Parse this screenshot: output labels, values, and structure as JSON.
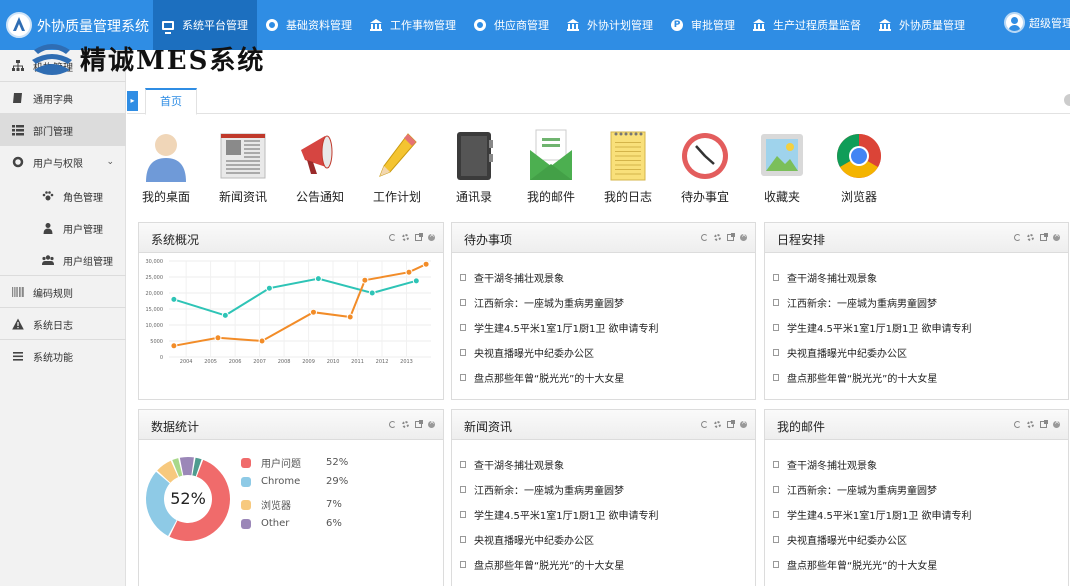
{
  "app": {
    "title": "外协质量管理系统"
  },
  "nav": [
    {
      "label": "系统平台管理",
      "icon": "monitor-icon",
      "active": true
    },
    {
      "label": "基础资料管理",
      "icon": "dot-circle-icon"
    },
    {
      "label": "工作事物管理",
      "icon": "bank-icon"
    },
    {
      "label": "供应商管理",
      "icon": "dot-circle-icon"
    },
    {
      "label": "外协计划管理",
      "icon": "bank-icon"
    },
    {
      "label": "审批管理",
      "icon": "p-badge-icon"
    },
    {
      "label": "生产过程质量监督",
      "icon": "bank-icon"
    },
    {
      "label": "外协质量管理",
      "icon": "bank-icon"
    }
  ],
  "user": {
    "name": "超级管理"
  },
  "watermark": {
    "text": "精诚MES系统"
  },
  "sidebar": [
    {
      "label": "机构管理",
      "icon": "sitemap-icon"
    },
    {
      "label": "通用字典",
      "icon": "book-icon"
    },
    {
      "label": "部门管理",
      "icon": "list-icon",
      "active": true
    },
    {
      "label": "用户与权限",
      "icon": "circle-icon",
      "caret": "⌄"
    },
    {
      "label": "角色管理",
      "icon": "paw-icon",
      "sub": true
    },
    {
      "label": "用户管理",
      "icon": "user-icon",
      "sub": true
    },
    {
      "label": "用户组管理",
      "icon": "users-icon",
      "sub": true
    },
    {
      "label": "编码规则",
      "icon": "barcode-icon"
    },
    {
      "label": "系统日志",
      "icon": "warning-icon"
    },
    {
      "label": "系统功能",
      "icon": "bars-icon"
    }
  ],
  "tabs": {
    "home": "首页"
  },
  "shortcuts": [
    {
      "label": "我的桌面",
      "icon": "desktop-user-icon"
    },
    {
      "label": "新闻资讯",
      "icon": "newspaper-icon"
    },
    {
      "label": "公告通知",
      "icon": "megaphone-icon"
    },
    {
      "label": "工作计划",
      "icon": "pencil-icon"
    },
    {
      "label": "通讯录",
      "icon": "address-book-icon"
    },
    {
      "label": "我的邮件",
      "icon": "mail-icon"
    },
    {
      "label": "我的日志",
      "icon": "notepad-icon"
    },
    {
      "label": "待办事宜",
      "icon": "clock-icon"
    },
    {
      "label": "收藏夹",
      "icon": "picture-icon"
    },
    {
      "label": "浏览器",
      "icon": "chrome-icon"
    }
  ],
  "news_items": [
    "查干湖冬捕壮观景象",
    "江西新余：一座城为重病男童圆梦",
    "学生建4.5平米1室1厅1厨1卫 欲申请专利",
    "央视直播曝光中纪委办公区",
    "盘点那些年曾“脱光光”的十大女星"
  ],
  "panels": {
    "overview": {
      "title": "系统概况"
    },
    "todo": {
      "title": "待办事项"
    },
    "schedule": {
      "title": "日程安排"
    },
    "stats": {
      "title": "数据统计",
      "center_label": "52%"
    },
    "news": {
      "title": "新闻资讯"
    },
    "mail": {
      "title": "我的邮件"
    }
  },
  "colors": {
    "primary": "#2f8de4",
    "teal": "#2ec4b6",
    "orange": "#f28c28"
  },
  "chart_data": [
    {
      "type": "line",
      "x": [
        "2004",
        "2005",
        "2006",
        "2007",
        "2008",
        "2009",
        "2010",
        "2011",
        "2012",
        "2013"
      ],
      "ylim": [
        0,
        30000
      ],
      "yticks": [
        "30,000",
        "25,000",
        "20,000",
        "15,000",
        "10,000",
        "5000",
        "0"
      ],
      "ytick_values": [
        30000,
        25000,
        20000,
        15000,
        10000,
        5000,
        0
      ],
      "series": [
        {
          "color": "#2ec4b6",
          "points": [
            [
              2003.5,
              18000
            ],
            [
              2005.6,
              13000
            ],
            [
              2007.4,
              21500
            ],
            [
              2009.4,
              24500
            ],
            [
              2011.6,
              20000
            ],
            [
              2013.4,
              23800
            ]
          ]
        },
        {
          "color": "#f28c28",
          "points": [
            [
              2003.5,
              3500
            ],
            [
              2005.3,
              6000
            ],
            [
              2007.1,
              5000
            ],
            [
              2009.2,
              14000
            ],
            [
              2010.7,
              12500
            ],
            [
              2011.3,
              24000
            ],
            [
              2013.1,
              26500
            ],
            [
              2013.8,
              29000
            ]
          ]
        }
      ]
    },
    {
      "type": "pie",
      "categories": [
        "用户问题",
        "Chrome",
        "浏览器",
        "Other"
      ],
      "values": [
        52,
        29,
        7,
        6
      ],
      "labels": [
        "52%",
        "29%",
        "7%",
        "6%"
      ],
      "colors": [
        "#f06b6b",
        "#8ecae6",
        "#f7c97e",
        "#9b87b8"
      ]
    }
  ]
}
